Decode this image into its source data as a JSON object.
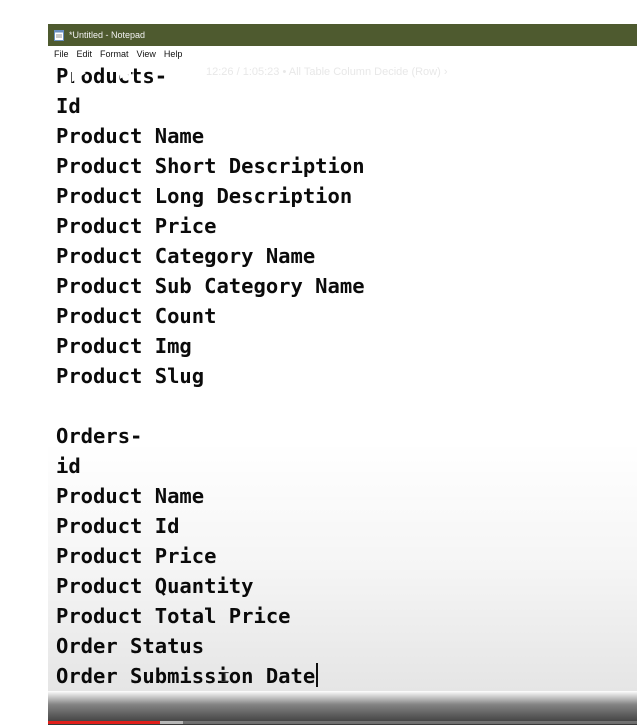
{
  "window": {
    "title": "*Untitled - Notepad"
  },
  "menu": [
    "File",
    "Edit",
    "Format",
    "View",
    "Help"
  ],
  "editor": {
    "lines": [
      "Products-",
      "Id",
      "Product Name",
      "Product Short Description",
      "Product Long Description",
      "Product Price",
      "Product Category Name",
      "Product Sub Category Name",
      "Product Count",
      "Product Img",
      "Product Slug",
      "",
      "Orders-",
      "id",
      "Product Name",
      "Product Id",
      "Product Price",
      "Product Quantity",
      "Product Total Price",
      "Order Status",
      "Order Submission Date"
    ]
  },
  "player": {
    "current_time": "12:26",
    "duration": "1:05:23",
    "chapter": "All Table Column Decide (Row)",
    "time_text": "12:26 / 1:05:23 • All Table Column Decide (Row)",
    "chapter_arrow": "›",
    "progress_fraction": 0.19,
    "buffer_fraction": 0.23,
    "accent_color": "#e0201b"
  },
  "colors": {
    "titlebar": "#4e5a2f",
    "text": "#0b0b0b"
  },
  "icons": [
    "notepad-icon",
    "play-icon",
    "next-icon",
    "volume-icon",
    "text-cursor-icon"
  ]
}
